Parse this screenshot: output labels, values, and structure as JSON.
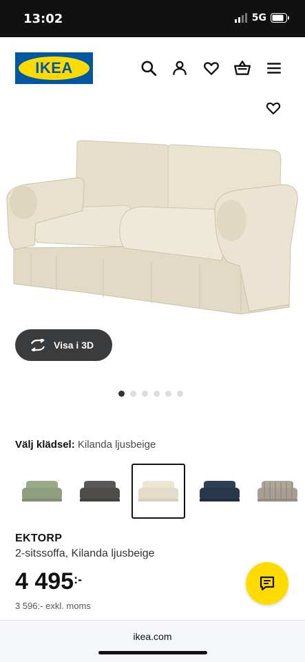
{
  "status": {
    "time": "13:02",
    "network": "5G"
  },
  "header": {
    "logo_text": "IKEA",
    "icons": [
      "search-icon",
      "user-icon",
      "heart-icon",
      "basket-icon",
      "menu-icon"
    ]
  },
  "gallery": {
    "view_3d_label": "Visa i 3D",
    "dot_count": 6,
    "active_dot": 1
  },
  "fabric": {
    "label": "Välj klädsel:",
    "value": "Kilanda ljusbeige",
    "swatches": [
      {
        "color": "#9aa98a",
        "selected": false
      },
      {
        "color": "#5a5854",
        "selected": false
      },
      {
        "color": "#e8e2d0",
        "selected": true
      },
      {
        "color": "#2f3f56",
        "selected": false
      },
      {
        "color": "#a89e91",
        "selected": false
      }
    ]
  },
  "product": {
    "name": "EKTORP",
    "description": "2-sitssoffa, Kilanda ljusbeige",
    "price": "4 495",
    "price_suffix": ":-",
    "price_excl": "3 596:- exkl. moms"
  },
  "browser": {
    "url": "ikea.com"
  },
  "colors": {
    "ikea_blue": "#0058A3",
    "ikea_yellow": "#FFDB00",
    "sofa_beige": "#e8e2d0"
  }
}
